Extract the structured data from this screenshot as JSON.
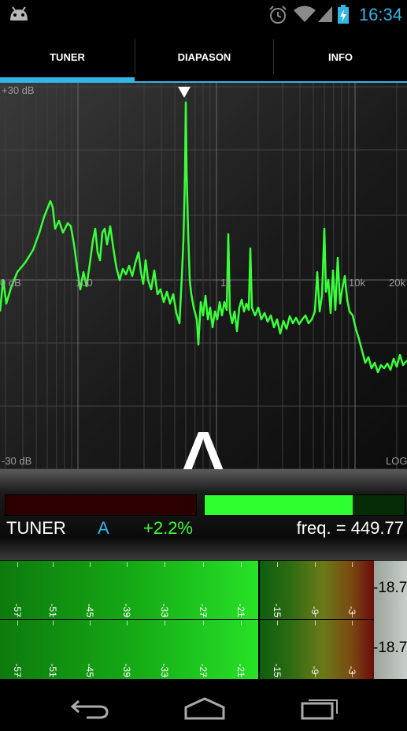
{
  "status": {
    "time": "16:34"
  },
  "tabs": [
    {
      "label": "TUNER",
      "active": true
    },
    {
      "label": "DIAPASON",
      "active": false
    },
    {
      "label": "INFO",
      "active": false
    }
  ],
  "spectrum": {
    "db_top": "+30 dB",
    "db_mid": "0 dB",
    "db_bottom": "-30 dB",
    "freq_labels": [
      "100",
      "1k",
      "10k",
      "20k"
    ],
    "scale_mode": "LOG",
    "note": "A",
    "trace_color": "#39ff39"
  },
  "tuner": {
    "label": "TUNER",
    "note": "A",
    "cents": "+2.2%",
    "freq": "freq. = 449.77",
    "right_bar_level": 0.74
  },
  "meter": {
    "ticks": [
      "-57",
      "-51",
      "-45",
      "-39",
      "-33",
      "-27",
      "-21",
      "-15",
      "-9",
      "-3"
    ],
    "readout_top": "-18.7",
    "readout_bottom": "-18.7"
  },
  "colors": {
    "accent": "#33b5e5",
    "green": "#3cff3c"
  }
}
